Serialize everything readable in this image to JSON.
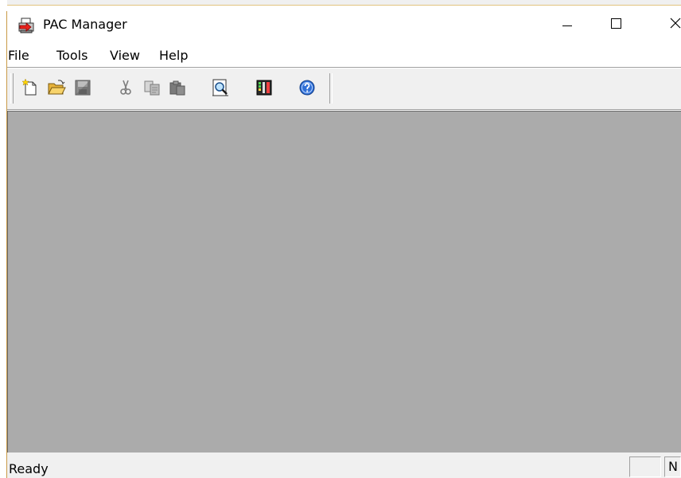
{
  "window": {
    "title": "PAC Manager",
    "icon": "pac-manager-app-icon"
  },
  "controls": {
    "minimize": "minimize-icon",
    "maximize": "maximize-icon",
    "close": "close-icon"
  },
  "menu": {
    "items": [
      {
        "label": "File"
      },
      {
        "label": "Tools"
      },
      {
        "label": "View"
      },
      {
        "label": "Help"
      }
    ]
  },
  "toolbar": {
    "buttons": [
      {
        "icon": "new-document-icon",
        "enabled": true
      },
      {
        "icon": "open-folder-icon",
        "enabled": true
      },
      {
        "icon": "save-disk-icon",
        "enabled": false
      },
      {
        "icon": "cut-scissors-icon",
        "enabled": false
      },
      {
        "icon": "copy-icon",
        "enabled": false
      },
      {
        "icon": "paste-icon",
        "enabled": false
      },
      {
        "icon": "print-preview-magnifier-icon",
        "enabled": true
      },
      {
        "icon": "settings-panel-icon",
        "enabled": true
      },
      {
        "icon": "help-question-icon",
        "enabled": true
      }
    ]
  },
  "statusbar": {
    "message": "Ready",
    "caps_pane": "",
    "num_pane": "N"
  },
  "colors": {
    "client_area": "#ababab",
    "chrome": "#f0f0f0",
    "accent_border": "#c99a47"
  }
}
